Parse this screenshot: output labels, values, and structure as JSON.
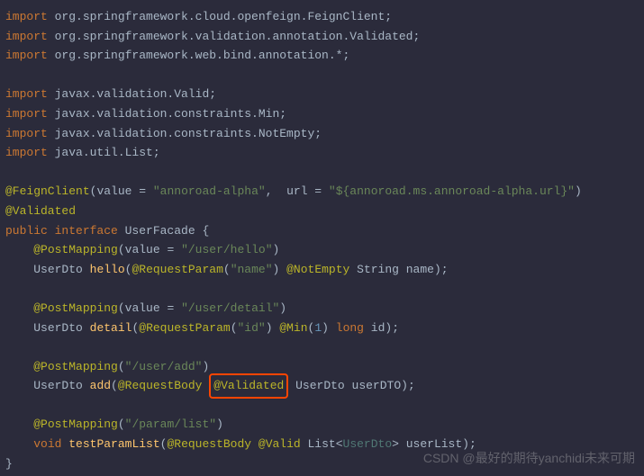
{
  "imports": {
    "l1_kw": "import",
    "l1_pkg": " org.springframework.cloud.openfeign.FeignClient;",
    "l2_kw": "import",
    "l2_pkg": " org.springframework.validation.annotation.Validated;",
    "l3_kw": "import",
    "l3_pkg": " org.springframework.web.bind.annotation.*;",
    "l4_kw": "import",
    "l4_pkg": " javax.validation.Valid;",
    "l5_kw": "import",
    "l5_pkg": " javax.validation.constraints.Min;",
    "l6_kw": "import",
    "l6_pkg": " javax.validation.constraints.NotEmpty;",
    "l7_kw": "import",
    "l7_pkg": " java.util.List;"
  },
  "feign": {
    "ann": "@FeignClient",
    "p1": "(",
    "valkey": "value",
    "eq1": " = ",
    "valstr": "\"annoroad-alpha\"",
    "comma": ",  ",
    "urlkey": "url",
    "eq2": " = ",
    "urlstr": "\"${annoroad.ms.annoroad-alpha.url}\"",
    "p2": ")"
  },
  "validated": "@Validated",
  "decl": {
    "pub": "public ",
    "itf": "interface ",
    "name": "UserFacade ",
    "brace": "{"
  },
  "m1": {
    "indent": "    ",
    "ann": "@PostMapping",
    "p1": "(",
    "valkey": "value",
    "eq": " = ",
    "valstr": "\"/user/hello\"",
    "p2": ")",
    "ret": "UserDto ",
    "name": "hello",
    "pp1": "(",
    "rp": "@RequestParam",
    "rpp1": "(",
    "rpstr": "\"name\"",
    "rpp2": ") ",
    "ne": "@NotEmpty ",
    "ptype": "String ",
    "pname": "name",
    "pp2": ");"
  },
  "m2": {
    "indent": "    ",
    "ann": "@PostMapping",
    "p1": "(",
    "valkey": "value",
    "eq": " = ",
    "valstr": "\"/user/detail\"",
    "p2": ")",
    "ret": "UserDto ",
    "name": "detail",
    "pp1": "(",
    "rp": "@RequestParam",
    "rpp1": "(",
    "rpstr": "\"id\"",
    "rpp2": ") ",
    "min": "@Min",
    "mp1": "(",
    "mnum": "1",
    "mp2": ") ",
    "ptype": "long ",
    "pname": "id",
    "pp2": ");"
  },
  "m3": {
    "indent": "    ",
    "ann": "@PostMapping",
    "p1": "(",
    "valstr": "\"/user/add\"",
    "p2": ")",
    "ret": "UserDto ",
    "name": "add",
    "pp1": "(",
    "rb": "@RequestBody ",
    "val": "@Validated",
    "space": " ",
    "ptype": "UserDto ",
    "pname": "userDTO",
    "pp2": ");"
  },
  "m4": {
    "indent": "    ",
    "ann": "@PostMapping",
    "p1": "(",
    "valstr": "\"/param/list\"",
    "p2": ")",
    "ret": "void ",
    "name": "testParamList",
    "pp1": "(",
    "rb": "@RequestBody ",
    "val": "@Valid ",
    "list": "List",
    "lt": "<",
    "gtype": "UserDto",
    "gt": "> ",
    "pname": "userList",
    "pp2": ");"
  },
  "close": "}",
  "watermark": "CSDN @最好的期待yanchidi未来可期"
}
